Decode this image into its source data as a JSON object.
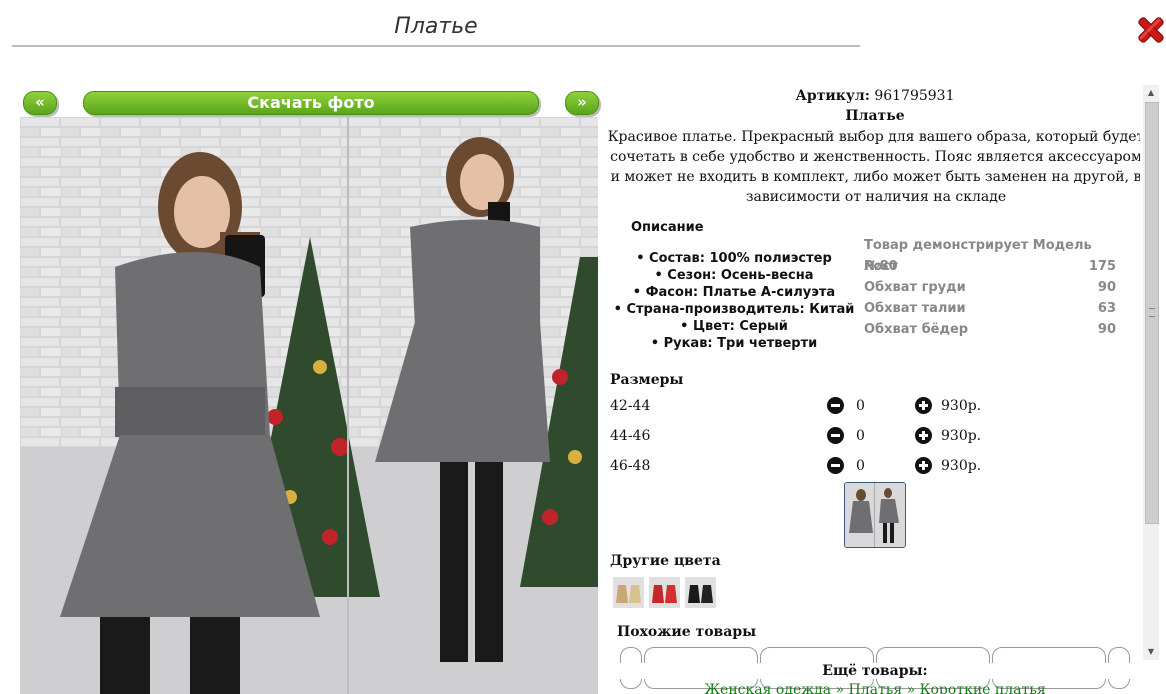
{
  "window": {
    "title": "Платье"
  },
  "gallery": {
    "prev_label": "«",
    "next_label": "»",
    "download_label": "Скачать фото"
  },
  "product": {
    "article_label": "Артикул:",
    "article_value": "961795931",
    "name": "Платье",
    "description": "Красивое платье. Прекрасный выбор для вашего образа, который будет сочетать в себе удобство и женственность. Пояс является аксессуаром и может не входить в комплект, либо может быть заменен на другой, в зависимости от наличия на складе"
  },
  "specs": {
    "heading": "Описание",
    "items": [
      "Состав: 100% полиэстер",
      "Сезон: Осень-весна",
      "Фасон: Платье А-силуэта",
      "Страна-производитель: Китай",
      "Цвет: Серый",
      "Рукав: Три четверти"
    ]
  },
  "model": {
    "rows": [
      {
        "label": "Товар демонстрирует Модель №80",
        "value": ""
      },
      {
        "label": "Рост",
        "value": "175"
      },
      {
        "label": "Обхват груди",
        "value": "90"
      },
      {
        "label": "Обхват талии",
        "value": "63"
      },
      {
        "label": "Обхват бёдер",
        "value": "90"
      }
    ]
  },
  "sizes": {
    "heading": "Размеры",
    "rows": [
      {
        "size": "42-44",
        "qty": "0",
        "price": "930р."
      },
      {
        "size": "44-46",
        "qty": "0",
        "price": "930р."
      },
      {
        "size": "46-48",
        "qty": "0",
        "price": "930р."
      }
    ]
  },
  "other_colors": {
    "heading": "Другие цвета",
    "count": 3
  },
  "similar": {
    "heading": "Похожие товары"
  },
  "more": {
    "heading": "Ещё товары:",
    "crumb1": "Женская одежда",
    "sep": " » ",
    "crumb2": "Платья",
    "crumb3": "Короткие платья"
  },
  "colors": {
    "accent_green": "#6cb824",
    "close_red": "#d42020",
    "link_green": "#1a7a1a",
    "dress_gray": "#6f6f72"
  }
}
